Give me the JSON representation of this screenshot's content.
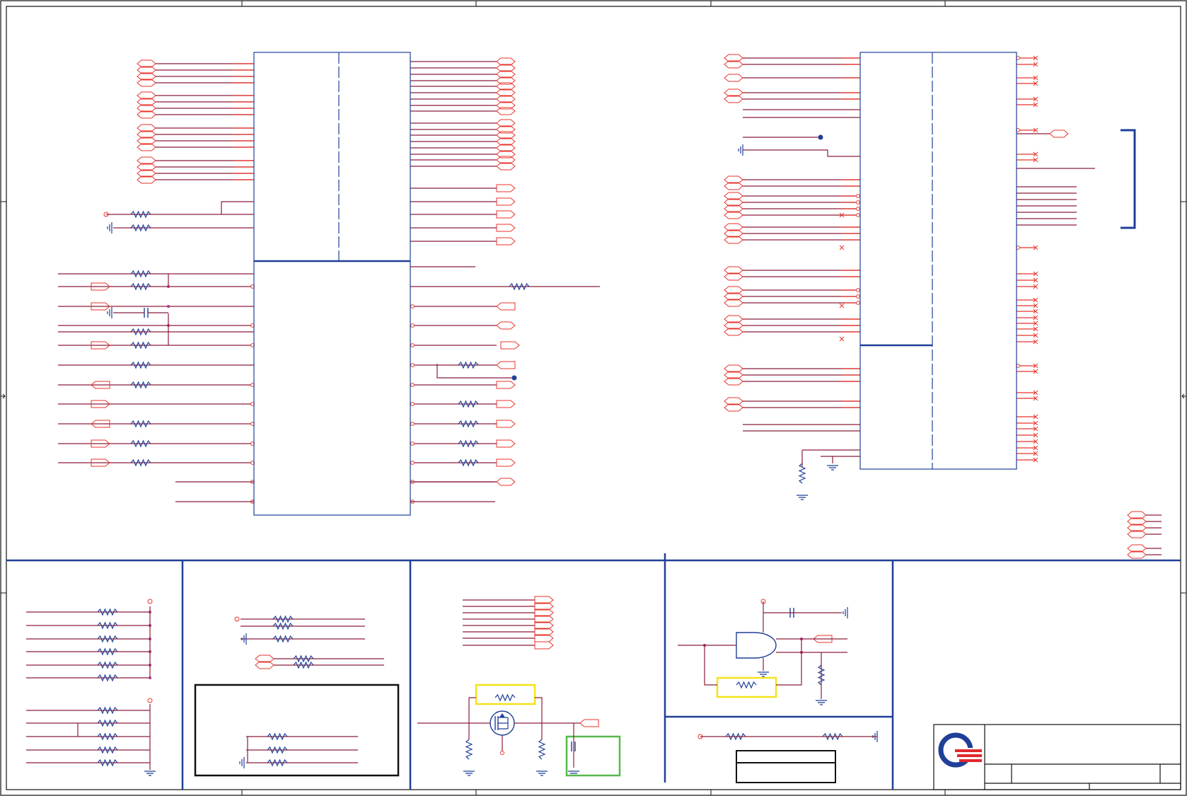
{
  "colors": {
    "wire_red": "#e8332b",
    "wire_dark": "#8a1d3a",
    "component_blue": "#1f3f98",
    "highlight_yellow": "#f3e31a",
    "highlight_green": "#57b94a",
    "logo_blue": "#1f3f98",
    "logo_red": "#e0282e",
    "frame_black": "#111111"
  },
  "icons": {
    "logo": "company-logo-icon",
    "ground": "ground-symbol-icon",
    "resistor": "resistor-symbol-icon",
    "capacitor": "capacitor-symbol-icon",
    "mosfet": "mosfet-symbol-icon",
    "and_gate": "and-gate-symbol-icon",
    "connector": "net-port-symbol-icon"
  }
}
